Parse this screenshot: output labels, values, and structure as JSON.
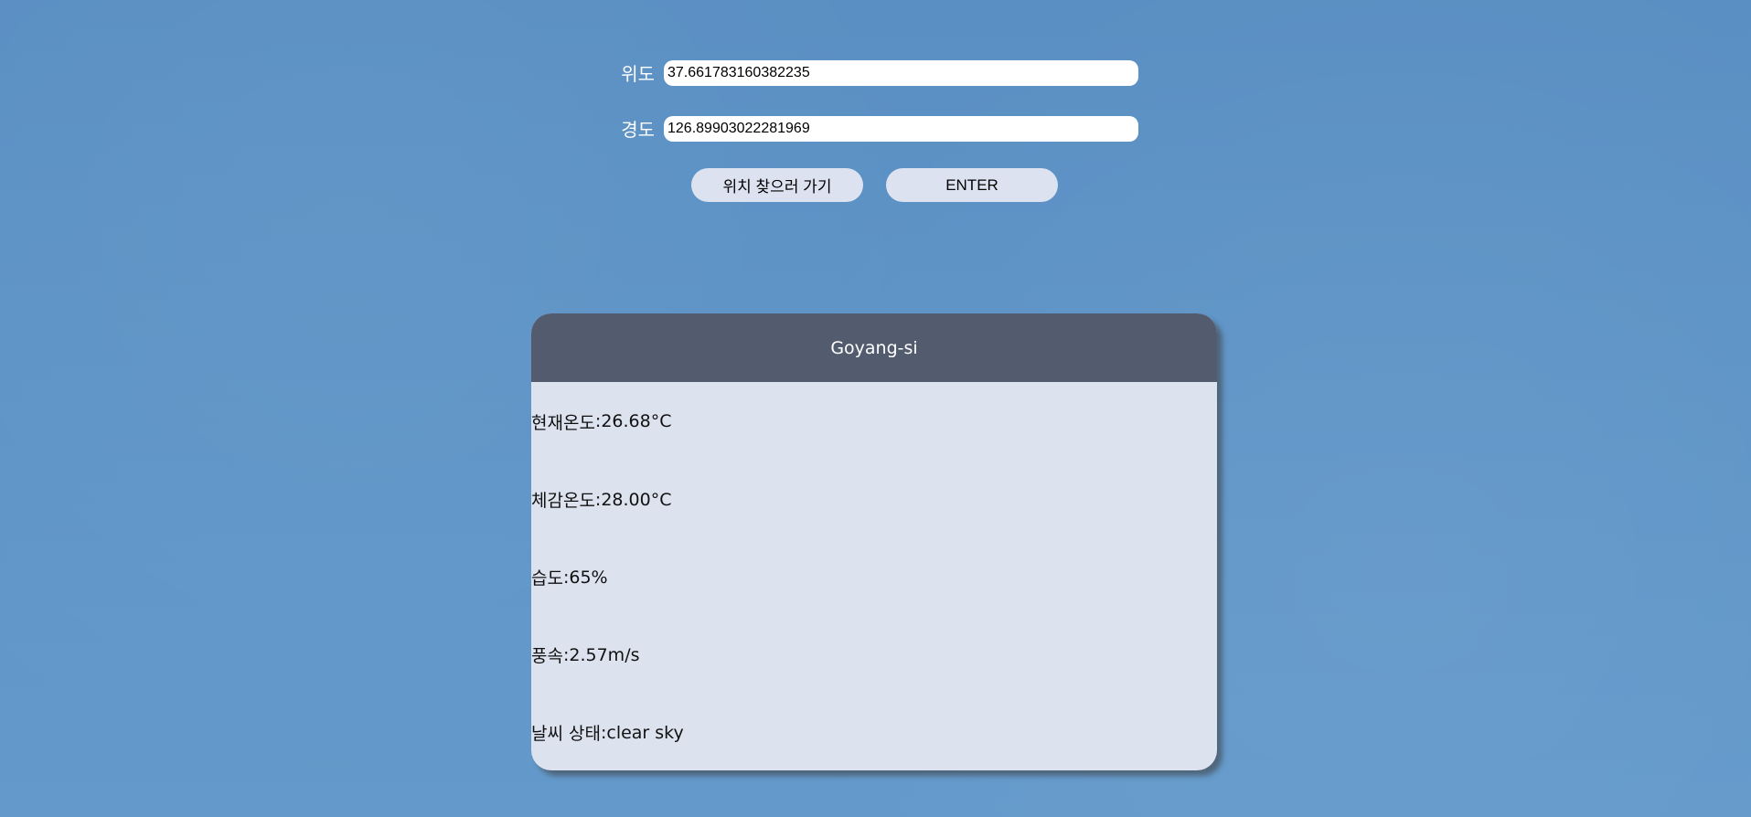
{
  "form": {
    "latitude": {
      "label": "위도",
      "value": "37.661783160382235"
    },
    "longitude": {
      "label": "경도",
      "value": "126.89903022281969"
    }
  },
  "buttons": {
    "find_location_label": "위치 찾으러 가기",
    "enter_label": "ENTER"
  },
  "weather": {
    "city": "Goyang-si",
    "rows": [
      {
        "label": "현재온도",
        "value": "26.68°C"
      },
      {
        "label": "체감온도",
        "value": "28.00°C"
      },
      {
        "label": "습도",
        "value": "65%"
      },
      {
        "label": "풍속",
        "value": "2.57m/s"
      },
      {
        "label": "날씨 상태",
        "value": "clear sky"
      }
    ]
  },
  "colors": {
    "background": "#5a8fc3",
    "card_header": "#525c6e",
    "card_body": "#dde2ef",
    "button": "#dde2f0"
  }
}
